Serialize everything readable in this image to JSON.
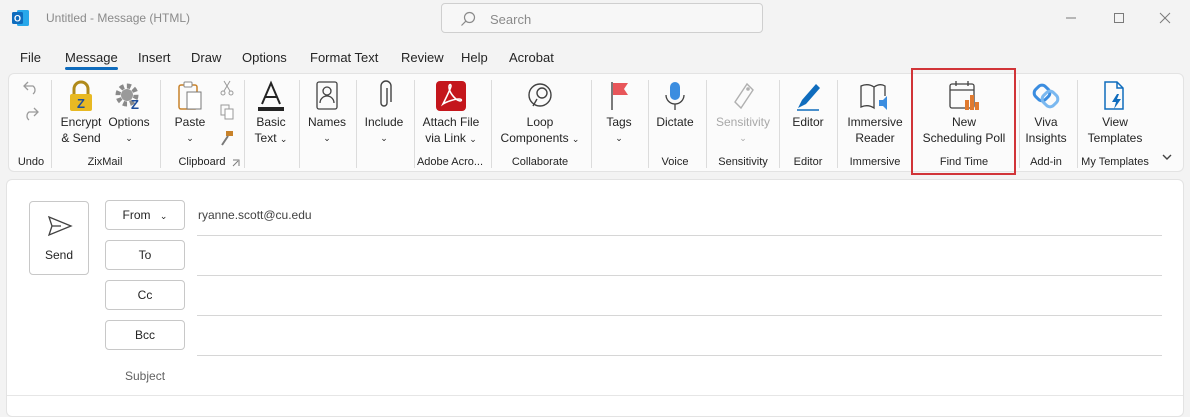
{
  "window": {
    "title": "Untitled  -  Message (HTML)",
    "search_placeholder": "Search",
    "app_icon_letter": "O"
  },
  "menu": {
    "tabs": [
      "File",
      "Message",
      "Insert",
      "Draw",
      "Options",
      "Format Text",
      "Review",
      "Help",
      "Acrobat"
    ],
    "active": "Message"
  },
  "ribbon": {
    "groups": {
      "undo": "Undo",
      "zixmail": "ZixMail",
      "clipboard": "Clipboard",
      "adobe": "Adobe Acro...",
      "collaborate": "Collaborate",
      "voice": "Voice",
      "sensitivity": "Sensitivity",
      "editor": "Editor",
      "immersive": "Immersive",
      "findtime": "Find Time",
      "addin": "Add-in",
      "templates": "My Templates"
    },
    "buttons": {
      "encrypt_l1": "Encrypt",
      "encrypt_l2": "& Send",
      "options_l1": "Options",
      "paste": "Paste",
      "basic_l1": "Basic",
      "basic_l2": "Text",
      "names": "Names",
      "include": "Include",
      "attach_l1": "Attach File",
      "attach_l2": "via Link",
      "loop_l1": "Loop",
      "loop_l2": "Components",
      "tags": "Tags",
      "dictate": "Dictate",
      "sensitivity": "Sensitivity",
      "editor": "Editor",
      "immersive_l1": "Immersive",
      "immersive_l2": "Reader",
      "poll_l1": "New",
      "poll_l2": "Scheduling Poll",
      "viva_l1": "Viva",
      "viva_l2": "Insights",
      "templates_l1": "View",
      "templates_l2": "Templates"
    },
    "chevron": "⌄"
  },
  "compose": {
    "send_label": "Send",
    "from_label": "From",
    "from_value": "ryanne.scott@cu.edu",
    "to_label": "To",
    "cc_label": "Cc",
    "bcc_label": "Bcc",
    "subject_label": "Subject"
  },
  "colors": {
    "accent": "#0f6cbd",
    "highlight": "#d13438",
    "adobe_red": "#c4161c"
  }
}
